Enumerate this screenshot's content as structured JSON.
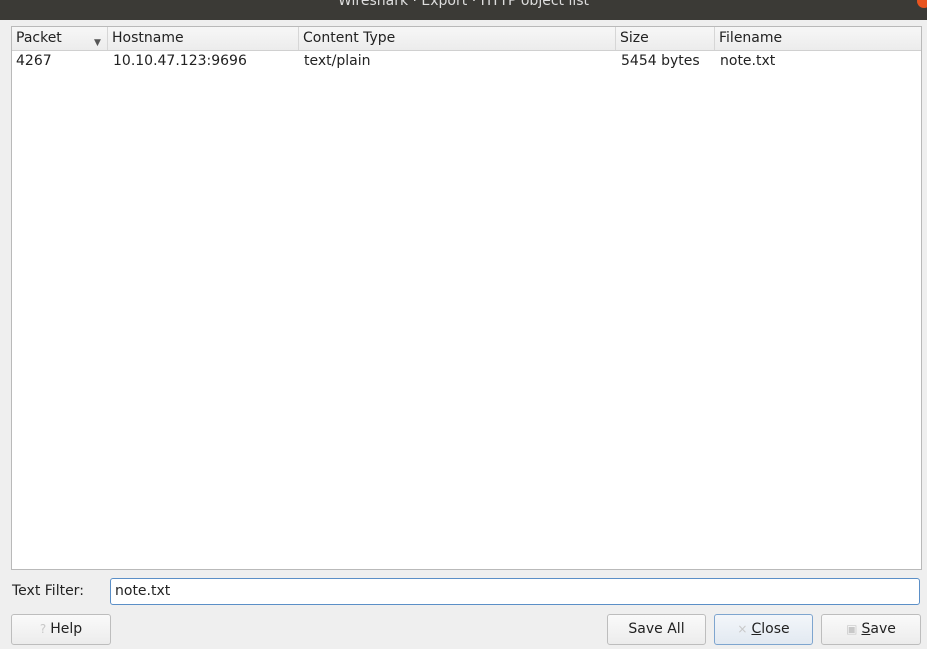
{
  "window": {
    "title": "Wireshark · Export · HTTP object list"
  },
  "table": {
    "columns": [
      "Packet",
      "Hostname",
      "Content Type",
      "Size",
      "Filename"
    ],
    "rows": [
      {
        "packet": "4267",
        "hostname": "10.10.47.123:9696",
        "content_type": "text/plain",
        "size": "5454 bytes",
        "filename": "note.txt"
      }
    ]
  },
  "filter": {
    "label": "Text Filter:",
    "value": "note.txt"
  },
  "buttons": {
    "help": "Help",
    "save_all": "Save All",
    "close_first": "C",
    "close_rest": "lose",
    "save_first": "S",
    "save_rest": "ave"
  }
}
